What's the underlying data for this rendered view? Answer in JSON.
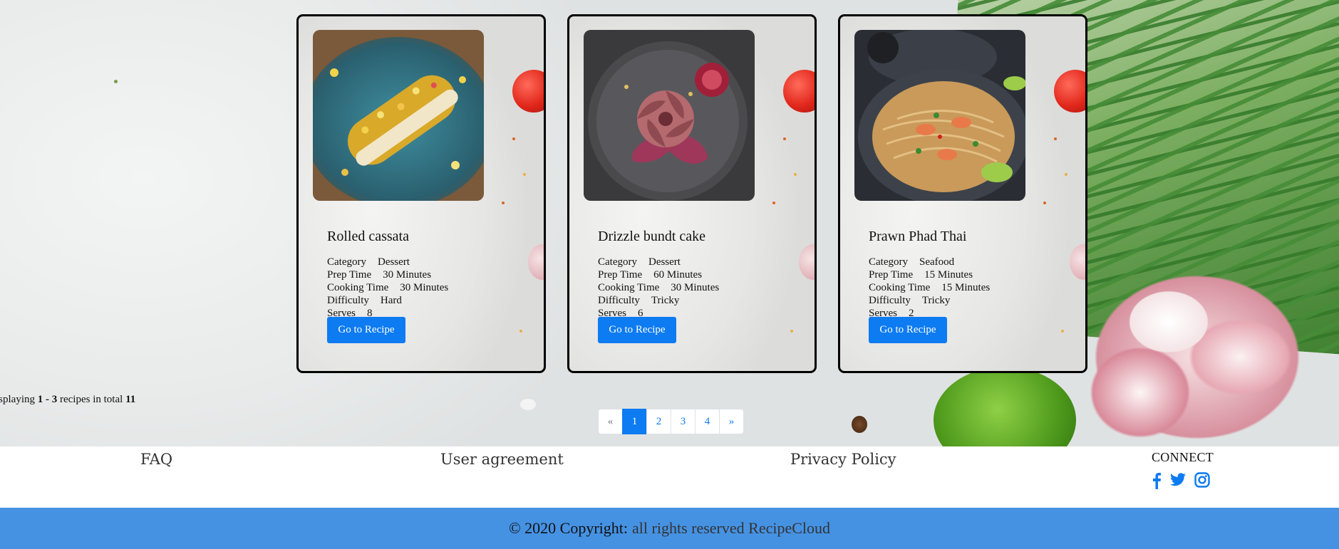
{
  "recipes": [
    {
      "title": "Rolled cassata",
      "details": [
        {
          "label": "Category",
          "value": "Dessert"
        },
        {
          "label": "Prep Time",
          "value": "30 Minutes"
        },
        {
          "label": "Cooking Time",
          "value": "30 Minutes"
        },
        {
          "label": "Difficulty",
          "value": "Hard"
        },
        {
          "label": "Serves",
          "value": "8"
        }
      ],
      "button_label": "Go to Recipe"
    },
    {
      "title": "Drizzle bundt cake",
      "details": [
        {
          "label": "Category",
          "value": "Dessert"
        },
        {
          "label": "Prep Time",
          "value": "60 Minutes"
        },
        {
          "label": "Cooking Time",
          "value": "30 Minutes"
        },
        {
          "label": "Difficulty",
          "value": "Tricky"
        },
        {
          "label": "Serves",
          "value": "6"
        }
      ],
      "button_label": "Go to Recipe"
    },
    {
      "title": "Prawn Phad Thai",
      "details": [
        {
          "label": "Category",
          "value": "Seafood"
        },
        {
          "label": "Prep Time",
          "value": "15 Minutes"
        },
        {
          "label": "Cooking Time",
          "value": "15 Minutes"
        },
        {
          "label": "Difficulty",
          "value": "Tricky"
        },
        {
          "label": "Serves",
          "value": "2"
        }
      ],
      "button_label": "Go to Recipe"
    }
  ],
  "summary": {
    "prefix": "isplaying",
    "range": "1 - 3",
    "middle": "recipes in total",
    "total": "11"
  },
  "pagination": {
    "prev": "«",
    "pages": [
      "1",
      "2",
      "3",
      "4"
    ],
    "next": "»",
    "active": "1"
  },
  "footer": {
    "faq": "FAQ",
    "user_agreement": "User agreement",
    "privacy_policy": "Privacy Policy",
    "connect": "CONNECT",
    "social_icons": [
      "facebook-icon",
      "twitter-icon",
      "instagram-icon"
    ]
  },
  "copyright": {
    "lead": "© 2020 Copyright:",
    "rest": "all rights reserved RecipeCloud"
  },
  "colors": {
    "primary": "#0d7bf2",
    "footer_bar": "#4592e3",
    "card_border": "#000000"
  }
}
